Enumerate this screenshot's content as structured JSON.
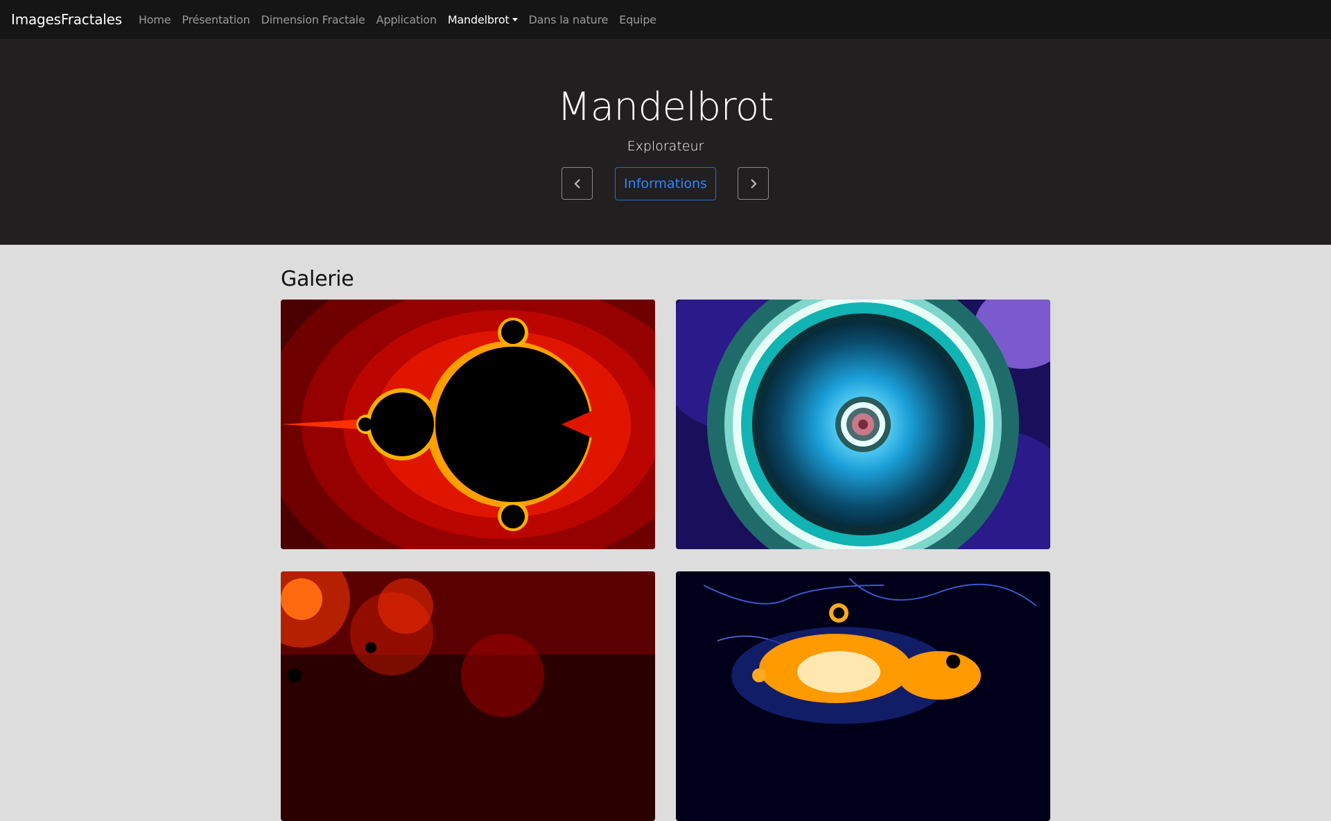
{
  "navbar": {
    "brand": "ImagesFractales",
    "items": [
      {
        "label": "Home"
      },
      {
        "label": "Présentation"
      },
      {
        "label": "Dimension Fractale"
      },
      {
        "label": "Application"
      },
      {
        "label": "Mandelbrot",
        "active": true,
        "dropdown": true
      },
      {
        "label": "Dans la nature"
      },
      {
        "label": "Equipe"
      }
    ]
  },
  "hero": {
    "title": "Mandelbrot",
    "subtitle": "Explorateur",
    "info_button": "Informations",
    "prev_icon": "chevron-left-icon",
    "next_icon": "chevron-right-icon"
  },
  "gallery": {
    "title": "Galerie",
    "images": [
      {
        "name": "mandelbrot-red-set",
        "palette": [
          "#000000",
          "#6b0000",
          "#c80000",
          "#ff4a00",
          "#ffd000"
        ]
      },
      {
        "name": "mandelbrot-cyan-spiral",
        "palette": [
          "#1a0a4a",
          "#0e3b3b",
          "#2cd1c9",
          "#2fb3e8",
          "#ffffff"
        ]
      },
      {
        "name": "mandelbrot-red-spirals",
        "palette": [
          "#1a0000",
          "#5a0000",
          "#ff3000"
        ]
      },
      {
        "name": "mandelbrot-blue-orange",
        "palette": [
          "#00001a",
          "#0a1a80",
          "#ff9a00",
          "#ffffff"
        ]
      }
    ]
  },
  "colors": {
    "navbar_bg": "#151515",
    "hero_bg": "#221f20",
    "page_bg": "#dddddd",
    "accent": "#2d87ff"
  }
}
